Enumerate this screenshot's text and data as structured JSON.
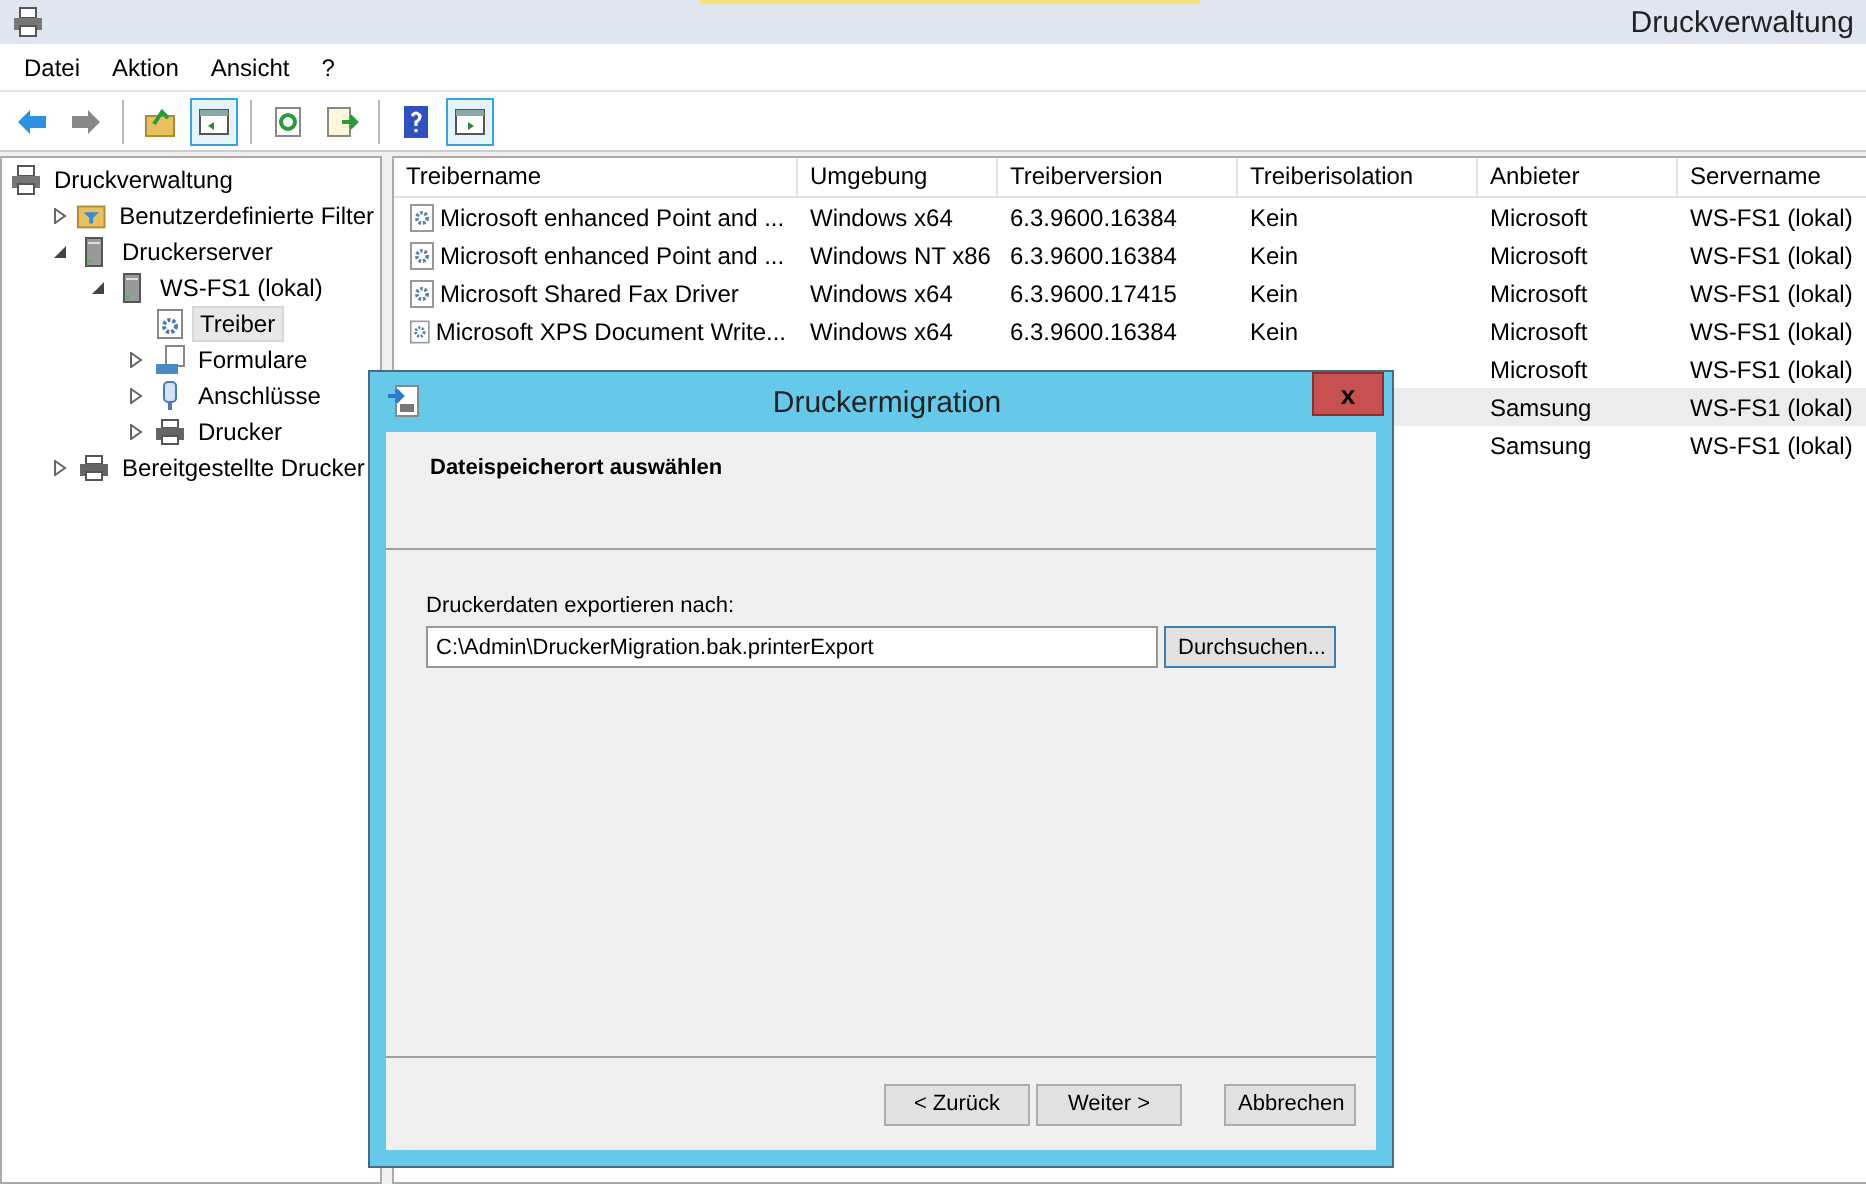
{
  "window": {
    "title": "Druckverwaltung"
  },
  "menu": [
    "Datei",
    "Aktion",
    "Ansicht",
    "?"
  ],
  "toolbar": [
    {
      "kind": "back"
    },
    {
      "kind": "forward"
    },
    {
      "kind": "sep"
    },
    {
      "kind": "up"
    },
    {
      "kind": "tree",
      "on": true
    },
    {
      "kind": "sep"
    },
    {
      "kind": "refresh"
    },
    {
      "kind": "export"
    },
    {
      "kind": "sep"
    },
    {
      "kind": "help"
    },
    {
      "kind": "actions",
      "on": true
    }
  ],
  "tree": [
    {
      "label": "Druckverwaltung",
      "kind": "root",
      "selected": false,
      "children": [
        {
          "label": "Benutzerdefinierte Filter",
          "kind": "filter",
          "expanded": false,
          "selected": false
        },
        {
          "label": "Druckerserver",
          "kind": "server",
          "expanded": true,
          "selected": false,
          "children": [
            {
              "label": "WS-FS1 (lokal)",
              "kind": "server",
              "expanded": true,
              "selected": false,
              "children": [
                {
                  "label": "Treiber",
                  "kind": "drivers",
                  "selected": true
                },
                {
                  "label": "Formulare",
                  "kind": "forms",
                  "expanded": false,
                  "selected": false
                },
                {
                  "label": "Anschlüsse",
                  "kind": "ports",
                  "expanded": false,
                  "selected": false
                },
                {
                  "label": "Drucker",
                  "kind": "printer",
                  "expanded": false,
                  "selected": false
                }
              ]
            }
          ]
        },
        {
          "label": "Bereitgestellte Drucker",
          "kind": "printer",
          "expanded": false,
          "selected": false
        }
      ]
    }
  ],
  "table": {
    "columns": [
      "Treibername",
      "Umgebung",
      "Treiberversion",
      "Treiberisolation",
      "Anbieter",
      "Servername"
    ],
    "rows": [
      {
        "selected": false,
        "cells": [
          "Microsoft enhanced Point and ...",
          "Windows x64",
          "6.3.9600.16384",
          "Kein",
          "Microsoft",
          "WS-FS1 (lokal)"
        ]
      },
      {
        "selected": false,
        "cells": [
          "Microsoft enhanced Point and ...",
          "Windows NT x86",
          "6.3.9600.16384",
          "Kein",
          "Microsoft",
          "WS-FS1 (lokal)"
        ]
      },
      {
        "selected": false,
        "cells": [
          "Microsoft Shared Fax Driver",
          "Windows x64",
          "6.3.9600.17415",
          "Kein",
          "Microsoft",
          "WS-FS1 (lokal)"
        ]
      },
      {
        "selected": false,
        "cells": [
          "Microsoft XPS Document Write...",
          "Windows x64",
          "6.3.9600.16384",
          "Kein",
          "Microsoft",
          "WS-FS1 (lokal)"
        ]
      },
      {
        "selected": false,
        "cells": [
          null,
          null,
          null,
          null,
          "Microsoft",
          "WS-FS1 (lokal)"
        ]
      },
      {
        "selected": true,
        "cells": [
          null,
          null,
          null,
          null,
          "Samsung",
          "WS-FS1 (lokal)"
        ]
      },
      {
        "selected": false,
        "cells": [
          null,
          null,
          null,
          null,
          "Samsung",
          "WS-FS1 (lokal)"
        ]
      }
    ]
  },
  "dialog": {
    "title": "Druckermigration",
    "close": "x",
    "heading": "Dateispeicherort auswählen",
    "field_label": "Druckerdaten exportieren nach:",
    "path": "C:\\Admin\\DruckerMigration.bak.printerExport",
    "browse": "Durchsuchen...",
    "buttons": [
      "< Zurück",
      "Weiter >",
      "Abbrechen"
    ]
  }
}
